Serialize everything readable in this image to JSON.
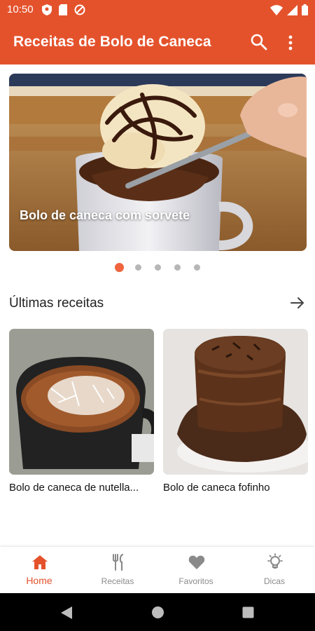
{
  "status_bar": {
    "time": "10:50"
  },
  "app_bar": {
    "title": "Receitas de Bolo de Caneca",
    "icons": [
      "search-icon",
      "more-vert-icon"
    ]
  },
  "carousel": {
    "slide_title": "Bolo de caneca com sorvete",
    "total_slides": 5,
    "active_index": 0
  },
  "latest": {
    "title": "Últimas receitas",
    "recipes": [
      {
        "title": "Bolo de caneca de nutella..."
      },
      {
        "title": "Bolo de caneca fofinho"
      }
    ]
  },
  "bottom_nav": {
    "items": [
      {
        "label": "Home",
        "icon": "home-icon",
        "active": true
      },
      {
        "label": "Receitas",
        "icon": "fork-knife-icon",
        "active": false
      },
      {
        "label": "Favoritos",
        "icon": "heart-icon",
        "active": false
      },
      {
        "label": "Dicas",
        "icon": "lightbulb-icon",
        "active": false
      }
    ]
  },
  "colors": {
    "primary": "#e4522c",
    "dot_active": "#f0643f",
    "dot_inactive": "#b7b7b7",
    "nav_inactive": "#8a8a8a"
  }
}
